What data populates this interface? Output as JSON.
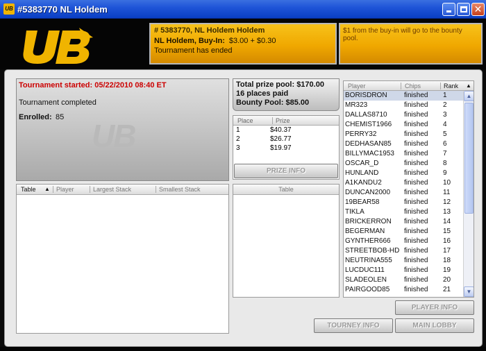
{
  "window": {
    "title": "#5383770 NL Holdem",
    "app_icon": "UB"
  },
  "header": {
    "tournament_title": "# 5383770, NL Holdem Holdem",
    "buyin_label": "NL Holdem, Buy-In:",
    "buyin_value": "$3.00 + $0.30",
    "status_line": "Tournament has ended",
    "bounty_note": "$1 from the buy-in will go to the bounty pool."
  },
  "status": {
    "started_label": "Tournament started:",
    "started_value": "05/22/2010 08:40 ET",
    "completed_text": "Tournament completed",
    "enrolled_label": "Enrolled:",
    "enrolled_value": "85",
    "watermark": "UB"
  },
  "prize": {
    "pool_label": "Total prize pool:",
    "pool_value": "$170.00",
    "places_paid": "16 places paid",
    "bounty_label": "Bounty Pool:",
    "bounty_value": "$85.00",
    "columns": {
      "place": "Place",
      "prize": "Prize"
    },
    "rows": [
      {
        "place": "1",
        "prize": "$40.37"
      },
      {
        "place": "2",
        "prize": "$26.77"
      },
      {
        "place": "3",
        "prize": "$19.97"
      }
    ],
    "button_label": "PRIZE INFO"
  },
  "tables": {
    "columns": {
      "table": "Table",
      "player": "Player",
      "largest": "Largest Stack",
      "smallest": "Smallest Stack"
    },
    "sort_indicator": "▲",
    "secondary_header": "Table"
  },
  "players": {
    "columns": {
      "player": "Player",
      "chips": "Chips",
      "rank": "Rank"
    },
    "sort_indicator": "▲",
    "rows": [
      {
        "player": "BORISDRON",
        "chips": "finished",
        "rank": "1"
      },
      {
        "player": "MR323",
        "chips": "finished",
        "rank": "2"
      },
      {
        "player": "DALLAS8710",
        "chips": "finished",
        "rank": "3"
      },
      {
        "player": "CHEMIST1966",
        "chips": "finished",
        "rank": "4"
      },
      {
        "player": "PERRY32",
        "chips": "finished",
        "rank": "5"
      },
      {
        "player": "DEDHASAN85",
        "chips": "finished",
        "rank": "6"
      },
      {
        "player": "BILLYMAC1953",
        "chips": "finished",
        "rank": "7"
      },
      {
        "player": "OSCAR_D",
        "chips": "finished",
        "rank": "8"
      },
      {
        "player": "HUNLAND",
        "chips": "finished",
        "rank": "9"
      },
      {
        "player": "A1KANDU2",
        "chips": "finished",
        "rank": "10"
      },
      {
        "player": "DUNCAN2000",
        "chips": "finished",
        "rank": "11"
      },
      {
        "player": "19BEAR58",
        "chips": "finished",
        "rank": "12"
      },
      {
        "player": "TIKLA",
        "chips": "finished",
        "rank": "13"
      },
      {
        "player": "BRICKERRON",
        "chips": "finished",
        "rank": "14"
      },
      {
        "player": "BEGERMAN",
        "chips": "finished",
        "rank": "15"
      },
      {
        "player": "GYNTHER666",
        "chips": "finished",
        "rank": "16"
      },
      {
        "player": "STREETBOB-HD",
        "chips": "finished",
        "rank": "17"
      },
      {
        "player": "NEUTRINA555",
        "chips": "finished",
        "rank": "18"
      },
      {
        "player": "LUCDUC111",
        "chips": "finished",
        "rank": "19"
      },
      {
        "player": "SLADEOLEN",
        "chips": "finished",
        "rank": "20"
      },
      {
        "player": "PAIRGOOD85",
        "chips": "finished",
        "rank": "21"
      }
    ]
  },
  "buttons": {
    "player_info": "PLAYER INFO",
    "tourney_info": "TOURNEY INFO",
    "main_lobby": "MAIN LOBBY"
  },
  "colors": {
    "accent_gold": "#f0a800",
    "title_blue": "#1f55d8",
    "started_red": "#cc0000"
  }
}
